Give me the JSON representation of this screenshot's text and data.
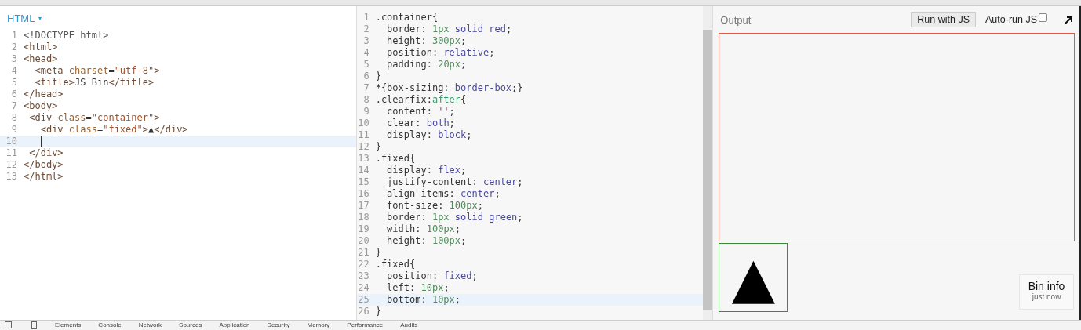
{
  "html_panel": {
    "title": "HTML",
    "caret": "▾",
    "lines": [
      {
        "number": "1",
        "text": "<!DOCTYPE html>",
        "active": false,
        "cursor": false
      },
      {
        "number": "2",
        "text": "<html>",
        "active": false,
        "cursor": false
      },
      {
        "number": "3",
        "text": "<head>",
        "active": false,
        "cursor": false
      },
      {
        "number": "4",
        "text": "  <meta charset=\"utf-8\">",
        "active": false,
        "cursor": false
      },
      {
        "number": "5",
        "text": "  <title>JS Bin</title>",
        "active": false,
        "cursor": false
      },
      {
        "number": "6",
        "text": "</head>",
        "active": false,
        "cursor": false
      },
      {
        "number": "7",
        "text": "<body>",
        "active": false,
        "cursor": false
      },
      {
        "number": "8",
        "text": " <div class=\"container\">",
        "active": false,
        "cursor": false
      },
      {
        "number": "9",
        "text": "   <div class=\"fixed\">▲</div>",
        "active": false,
        "cursor": false
      },
      {
        "number": "10",
        "active": true,
        "cursor": true
      },
      {
        "number": "11",
        "text": " </div>",
        "active": false,
        "cursor": false
      },
      {
        "number": "12",
        "text": "</body>",
        "active": false,
        "cursor": false
      },
      {
        "number": "13",
        "text": "</html>",
        "active": false,
        "cursor": false
      }
    ]
  },
  "css_panel": {
    "lines": [
      {
        "number": "1",
        "text": ".container{",
        "active": false
      },
      {
        "number": "2",
        "text": "  border: 1px solid red;",
        "active": false
      },
      {
        "number": "3",
        "text": "  height: 300px;",
        "active": false
      },
      {
        "number": "4",
        "text": "  position: relative;",
        "active": false
      },
      {
        "number": "5",
        "text": "  padding: 20px;",
        "active": false
      },
      {
        "number": "6",
        "text": "}",
        "active": false
      },
      {
        "number": "7",
        "text": "*{box-sizing: border-box;}",
        "active": false
      },
      {
        "number": "8",
        "text": ".clearfix:after{",
        "active": false
      },
      {
        "number": "9",
        "text": "  content: '';",
        "active": false
      },
      {
        "number": "10",
        "text": "  clear: both;",
        "active": false
      },
      {
        "number": "11",
        "text": "  display: block;",
        "active": false
      },
      {
        "number": "12",
        "text": "}",
        "active": false
      },
      {
        "number": "13",
        "text": ".fixed{",
        "active": false
      },
      {
        "number": "14",
        "text": "  display: flex;",
        "active": false
      },
      {
        "number": "15",
        "text": "  justify-content: center;",
        "active": false
      },
      {
        "number": "16",
        "text": "  align-items: center;",
        "active": false
      },
      {
        "number": "17",
        "text": "  font-size: 100px;",
        "active": false
      },
      {
        "number": "18",
        "text": "  border: 1px solid green;",
        "active": false
      },
      {
        "number": "19",
        "text": "  width: 100px;",
        "active": false
      },
      {
        "number": "20",
        "text": "  height: 100px;",
        "active": false
      },
      {
        "number": "21",
        "text": "}",
        "active": false
      },
      {
        "number": "22",
        "text": ".fixed{",
        "active": false
      },
      {
        "number": "23",
        "text": "  position: fixed;",
        "active": false
      },
      {
        "number": "24",
        "text": "  left: 10px;",
        "active": false
      },
      {
        "number": "25",
        "text": "  bottom: 10px;",
        "active": true
      },
      {
        "number": "26",
        "text": "}",
        "active": false
      }
    ]
  },
  "output_panel": {
    "title": "Output",
    "run_button": "Run with JS",
    "autorun": {
      "label": "Auto-run JS",
      "checked": false
    },
    "fixed_box": {
      "glyph": "▲"
    },
    "bin_info": {
      "title": "Bin info",
      "time": "just now"
    }
  },
  "devtools": {
    "tabs": [
      "Elements",
      "Console",
      "Network",
      "Sources",
      "Application",
      "Security",
      "Memory",
      "Performance",
      "Audits"
    ]
  }
}
